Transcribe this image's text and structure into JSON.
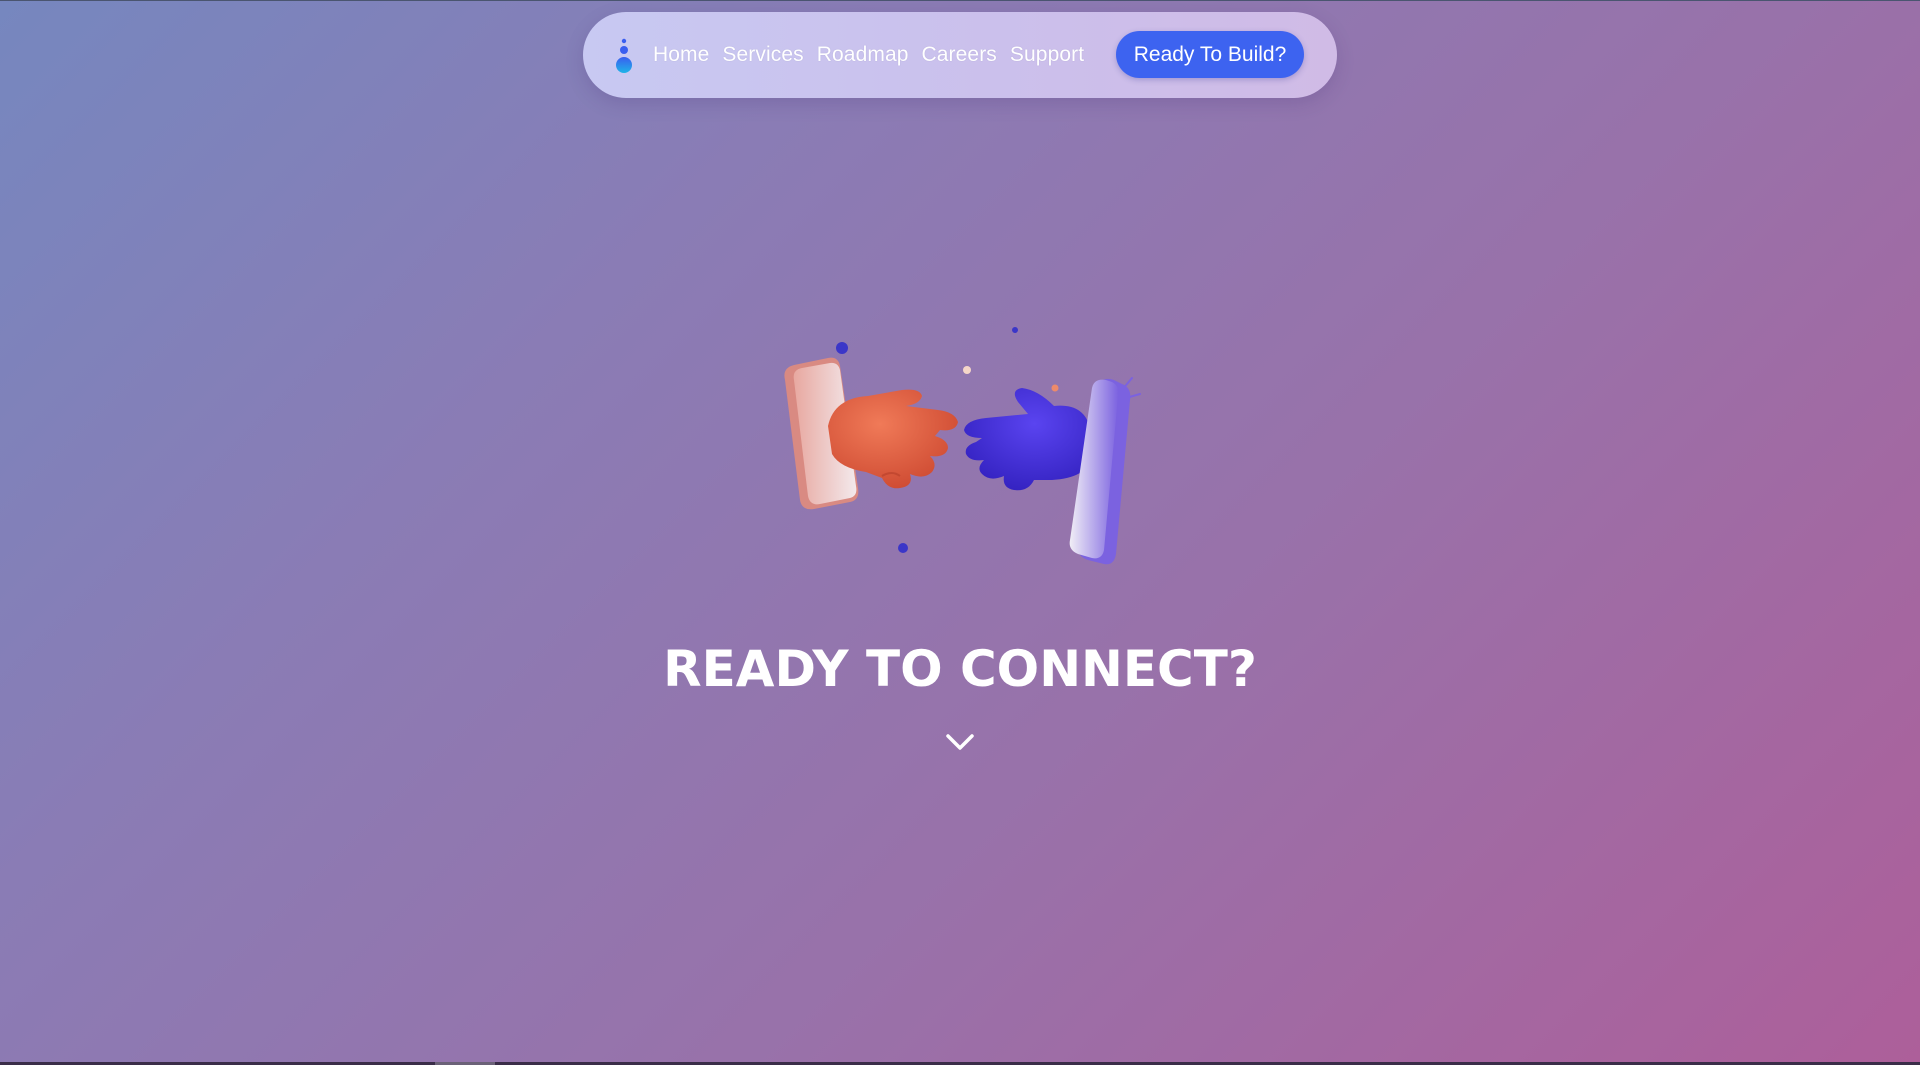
{
  "navbar": {
    "logo_icon": "droplets-logo-icon",
    "links": [
      {
        "label": "Home"
      },
      {
        "label": "Services"
      },
      {
        "label": "Roadmap"
      },
      {
        "label": "Careers"
      },
      {
        "label": "Support"
      }
    ],
    "cta_label": "Ready To Build?"
  },
  "hero": {
    "illustration": "hands-reaching-from-phones-illustration",
    "title": "READY TO CONNECT?",
    "scroll_icon": "chevron-down-icon"
  },
  "colors": {
    "accent": "#3d63f0",
    "hand_left": "#e0573c",
    "hand_right": "#3a25d4",
    "background_start": "#7687bf",
    "background_end": "#ad5f9a"
  }
}
